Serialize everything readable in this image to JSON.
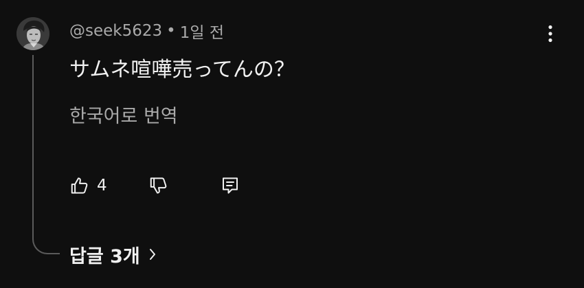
{
  "comment": {
    "author": "@seek5623",
    "separator": "•",
    "time": "1일 전",
    "text": "サムネ喧嘩売ってんの？",
    "translate_label": "한국어로 번역",
    "like_count": "4",
    "replies_label": "답글 3개"
  },
  "icons": {
    "more": "more-vertical-icon",
    "like": "thumbs-up-icon",
    "dislike": "thumbs-down-icon",
    "reply": "reply-comment-icon",
    "chevron": "chevron-right-icon"
  },
  "colors": {
    "background": "#0f0f0f",
    "primary_text": "#f1f1f1",
    "secondary_text": "#aaaaaa",
    "thread_line": "#5b5b5b"
  }
}
